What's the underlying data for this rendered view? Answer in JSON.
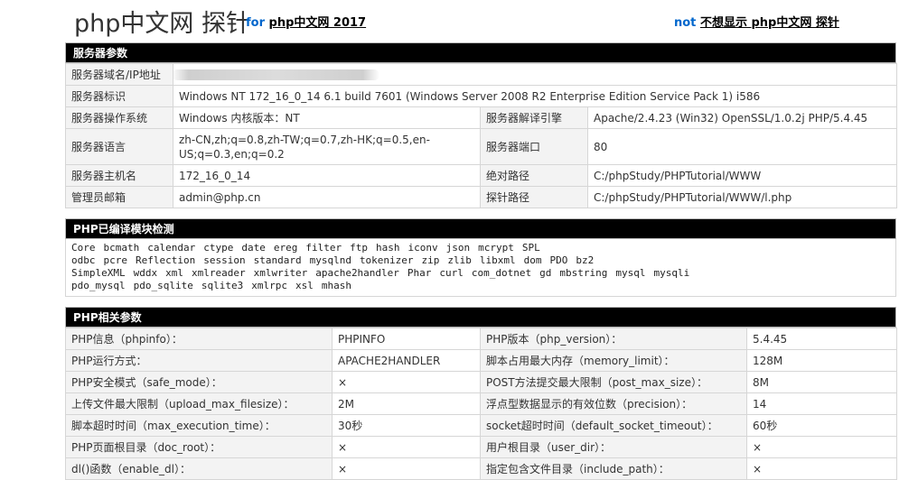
{
  "header": {
    "brand": "php中文网 探针",
    "for_kw": "for",
    "for_link": "php中文网 2017",
    "not_kw": "not",
    "hide_link": "不想显示 php中文网 探针"
  },
  "server_params": {
    "title": "服务器参数",
    "domain_label": "服务器域名/IP地址",
    "id_label": "服务器标识",
    "id_value": "Windows NT 172_16_0_14 6.1 build 7601 (Windows Server 2008 R2 Enterprise Edition Service Pack 1) i586",
    "os_label": "服务器操作系统",
    "os_value": "Windows  内核版本：NT",
    "engine_label": "服务器解译引擎",
    "engine_value": "Apache/2.4.23 (Win32) OpenSSL/1.0.2j PHP/5.4.45",
    "lang_label": "服务器语言",
    "lang_value": "zh-CN,zh;q=0.8,zh-TW;q=0.7,zh-HK;q=0.5,en-US;q=0.3,en;q=0.2",
    "port_label": "服务器端口",
    "port_value": "80",
    "host_label": "服务器主机名",
    "host_value": "172_16_0_14",
    "abspath_label": "绝对路径",
    "abspath_value": "C:/phpStudy/PHPTutorial/WWW",
    "admin_label": "管理员邮箱",
    "admin_value": "admin@php.cn",
    "probepath_label": "探针路径",
    "probepath_value": "C:/phpStudy/PHPTutorial/WWW/l.php"
  },
  "modules": {
    "title": "PHP已编译模块检测",
    "list": [
      "Core",
      "bcmath",
      "calendar",
      "ctype",
      "date",
      "ereg",
      "filter",
      "ftp",
      "hash",
      "iconv",
      "json",
      "mcrypt",
      "SPL",
      "odbc",
      "pcre",
      "Reflection",
      "session",
      "standard",
      "mysqlnd",
      "tokenizer",
      "zip",
      "zlib",
      "libxml",
      "dom",
      "PDO",
      "bz2",
      "SimpleXML",
      "wddx",
      "xml",
      "xmlreader",
      "xmlwriter",
      "apache2handler",
      "Phar",
      "curl",
      "com_dotnet",
      "gd",
      "mbstring",
      "mysql",
      "mysqli",
      "pdo_mysql",
      "pdo_sqlite",
      "sqlite3",
      "xmlrpc",
      "xsl",
      "mhash"
    ]
  },
  "php_params": {
    "title": "PHP相关参数",
    "rows": [
      {
        "l1": "PHP信息（phpinfo）：",
        "v1": "PHPINFO",
        "l2": "PHP版本（php_version）：",
        "v2": "5.4.45"
      },
      {
        "l1": "PHP运行方式：",
        "v1": "APACHE2HANDLER",
        "l2": "脚本占用最大内存（memory_limit）：",
        "v2": "128M"
      },
      {
        "l1": "PHP安全模式（safe_mode）：",
        "v1": "×",
        "l2": "POST方法提交最大限制（post_max_size）：",
        "v2": "8M"
      },
      {
        "l1": "上传文件最大限制（upload_max_filesize）：",
        "v1": "2M",
        "l2": "浮点型数据显示的有效位数（precision）：",
        "v2": "14"
      },
      {
        "l1": "脚本超时时间（max_execution_time）：",
        "v1": "30秒",
        "l2": "socket超时时间（default_socket_timeout）：",
        "v2": "60秒"
      },
      {
        "l1": "PHP页面根目录（doc_root）：",
        "v1": "×",
        "l2": "用户根目录（user_dir）：",
        "v2": "×"
      },
      {
        "l1": "dl()函数（enable_dl）：",
        "v1": "×",
        "l2": "指定包含文件目录（include_path）：",
        "v2": "×"
      }
    ]
  }
}
